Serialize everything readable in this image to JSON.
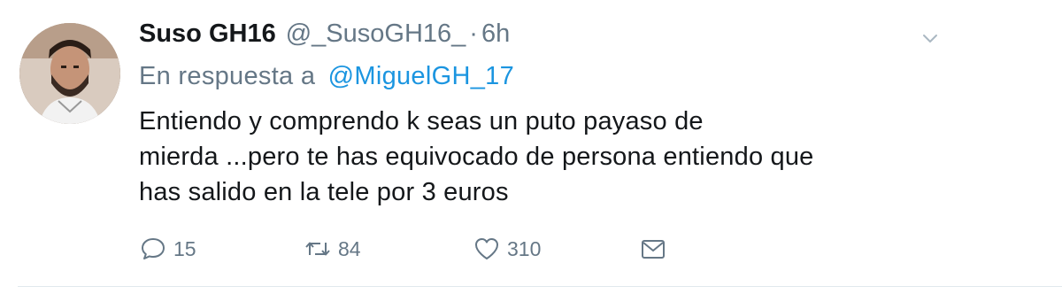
{
  "tweet": {
    "author_name": "Suso GH16",
    "author_handle": "@_SusoGH16_",
    "separator": "·",
    "time": "6h",
    "reply_prefix": "En respuesta a",
    "reply_to": "@MiguelGH_17",
    "text_lines": [
      "Entiendo y comprendo k seas un puto payaso de",
      "mierda ...pero te has equivocado de persona entiendo que",
      "has salido en la tele por 3 euros"
    ]
  },
  "actions": {
    "reply": {
      "icon": "reply-icon",
      "count": "15"
    },
    "retweet": {
      "icon": "retweet-icon",
      "count": "84"
    },
    "like": {
      "icon": "heart-icon",
      "count": "310"
    },
    "dm": {
      "icon": "envelope-icon"
    }
  },
  "menu": {
    "icon": "chevron-down-icon"
  },
  "colors": {
    "link": "#1b95e0",
    "secondary_text": "#657786",
    "primary_text": "#14171a",
    "icon": "#657786"
  }
}
